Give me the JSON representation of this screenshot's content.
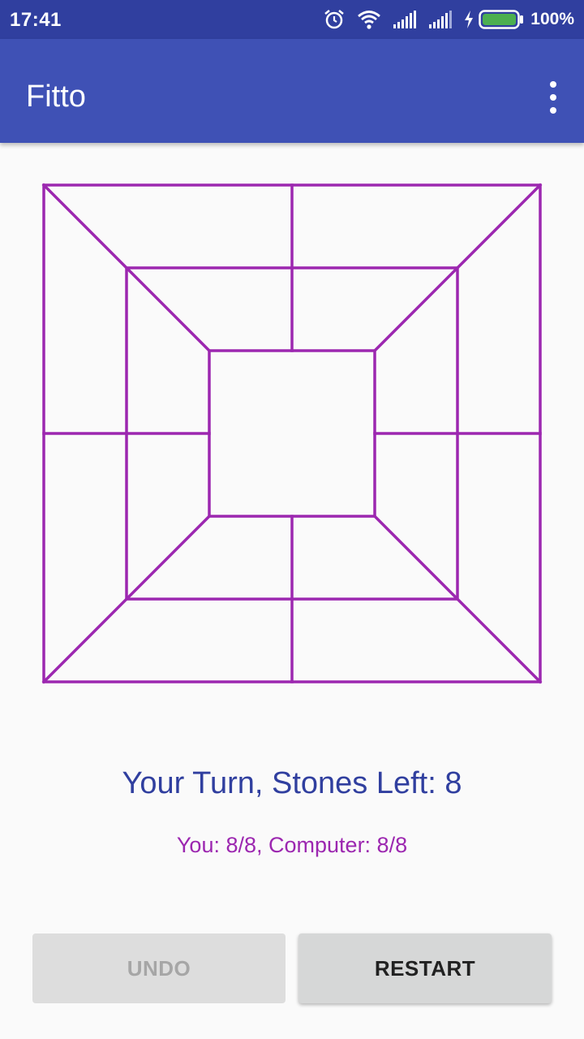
{
  "status_bar": {
    "time": "17:41",
    "battery_percent": "100%",
    "icons": [
      "alarm-icon",
      "wifi-icon",
      "signal-icon",
      "signal-icon",
      "charging-icon",
      "battery-icon"
    ],
    "battery_color": "#4caf50"
  },
  "app_bar": {
    "title": "Fitto",
    "menu_icon": "overflow-menu-icon"
  },
  "board": {
    "line_color": "#9c27b0"
  },
  "game": {
    "turn_text": "Your Turn, Stones Left: 8",
    "score_text": "You: 8/8, Computer: 8/8"
  },
  "buttons": {
    "undo_label": "UNDO",
    "undo_enabled": false,
    "restart_label": "RESTART"
  },
  "colors": {
    "primary": "#3f51b5",
    "primary_dark": "#303f9f",
    "accent": "#9c27b0"
  }
}
